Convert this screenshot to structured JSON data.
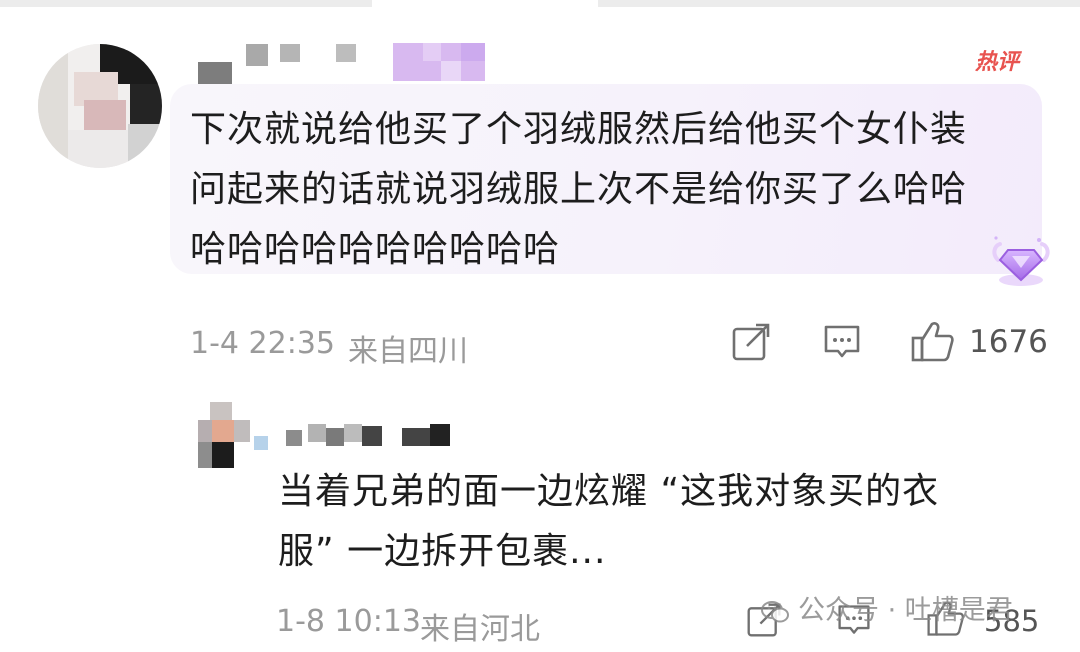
{
  "main_comment": {
    "badge": "热评",
    "text_lines": [
      "下次就说给他买了个羽绒服然后给他买个女仆装",
      "问起来的话就说羽绒服上次不是给你买了么哈哈",
      "哈哈哈哈哈哈哈哈哈哈"
    ],
    "timestamp": "1-4 22:35",
    "location": "来自四川",
    "like_count": "1676",
    "icons": [
      "share-icon",
      "comment-icon",
      "like-icon",
      "gem-icon"
    ]
  },
  "reply": {
    "text_lines": [
      "当着兄弟的面一边炫耀 “这我对象买的衣",
      "服” 一边拆开包裹..."
    ],
    "timestamp": "1-8 10:13",
    "location": "来自河北",
    "like_count": "585",
    "icons": [
      "share-icon",
      "comment-icon",
      "like-icon"
    ]
  },
  "watermark": {
    "text": "公众号 · 吐槽是君"
  },
  "colors": {
    "hot_badge": "#e8534f",
    "bubble_bg": "#f6f2fb",
    "meta_text": "#9a9a9a",
    "gem": "#b27ff0"
  }
}
